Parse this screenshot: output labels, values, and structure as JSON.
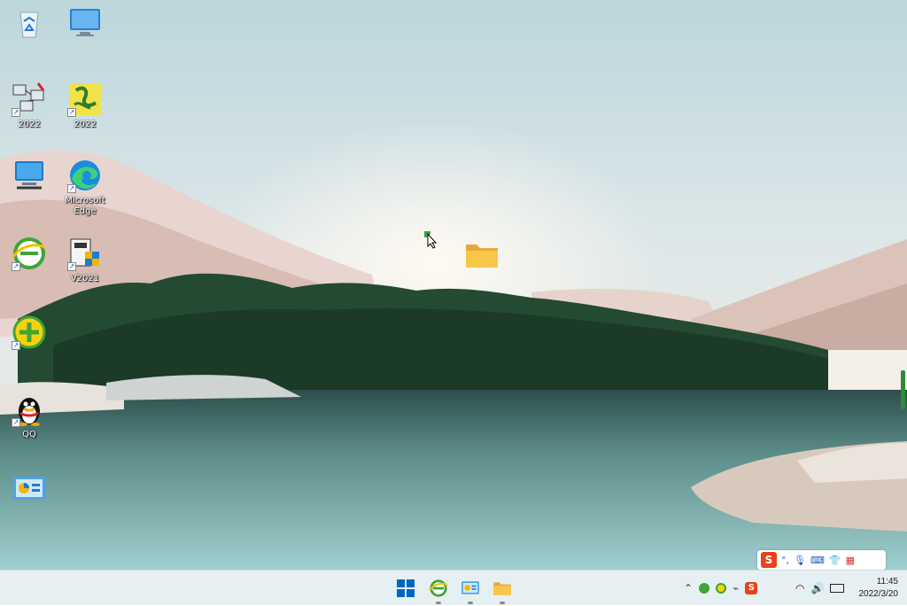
{
  "desktop": {
    "icons": [
      {
        "name": "recycle-bin",
        "label": ""
      },
      {
        "name": "this-pc",
        "label": ""
      },
      {
        "name": "app-a",
        "label": "2022"
      },
      {
        "name": "app-b",
        "label": "2022"
      },
      {
        "name": "network",
        "label": ""
      },
      {
        "name": "edge",
        "label": "Microsoft\nEdge"
      },
      {
        "name": "360-browser",
        "label": ""
      },
      {
        "name": "recorder",
        "label": "V2021"
      },
      {
        "name": "360-safe",
        "label": ""
      },
      {
        "name": "qq",
        "label": "QQ"
      },
      {
        "name": "control-panel",
        "label": ""
      },
      {
        "name": "folder",
        "label": ""
      }
    ]
  },
  "ime": {
    "logo": "S"
  },
  "taskbar": {
    "apps": [
      "windows-start",
      "360-browser",
      "control-panel",
      "file-explorer"
    ],
    "tray_logo": "S"
  },
  "clock": {
    "time": "11:45",
    "date": "2022/3/20"
  },
  "colors": {
    "taskbar": "#e6f0f2",
    "accent": "#0067c0",
    "ime_brand": "#e8411c"
  }
}
